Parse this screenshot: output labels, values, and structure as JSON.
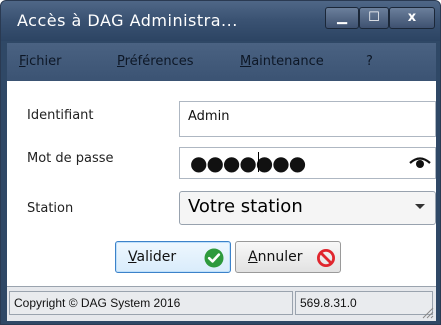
{
  "window": {
    "title": "Accès à DAG Administra...",
    "controls": {
      "minimize": "▁",
      "maximize": "☐",
      "close": "x"
    }
  },
  "menu": {
    "fichier": {
      "first": "F",
      "rest": "ichier"
    },
    "preferences": {
      "first": "P",
      "rest": "références"
    },
    "maintenance": {
      "first": "M",
      "rest": "aintenance"
    },
    "help": "?"
  },
  "form": {
    "identifiant_label": "Identifiant",
    "identifiant_value": "Admin",
    "password_label": "Mot de passe",
    "password_mask": "●●●●●●●",
    "station_label": "Station",
    "station_value": "Votre station"
  },
  "actions": {
    "validate": {
      "first": "V",
      "rest": "alider"
    },
    "cancel": {
      "first": "A",
      "rest": "nnuler"
    }
  },
  "status": {
    "copyright": "Copyright © DAG System 2016",
    "version": "569.8.31.0"
  },
  "icons": {
    "validate": "check-circle-icon",
    "cancel": "no-entry-icon",
    "show_password": "eye-icon"
  },
  "colors": {
    "titlebar": "#3b5373",
    "validate_icon": "#2e9a3d",
    "cancel_icon": "#e0262e"
  }
}
